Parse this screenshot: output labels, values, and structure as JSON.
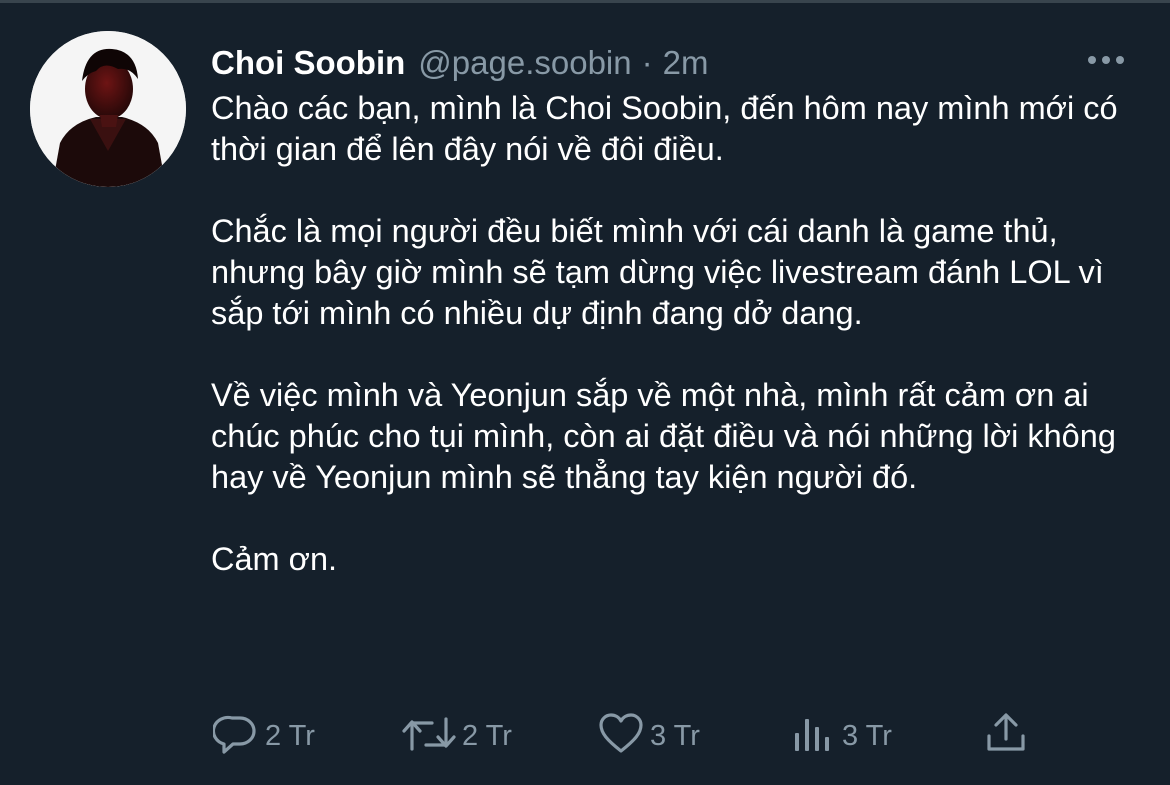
{
  "tweet": {
    "author_name": "Choi Soobin",
    "author_handle": "@page.soobin",
    "separator": "·",
    "timestamp": "2m",
    "paragraphs": [
      "Chào các bạn, mình là Choi Soobin, đến hôm nay mình mới có thời gian để lên đây nói về đôi điều.",
      "Chắc là mọi người đều biết mình với cái danh là game thủ, nhưng bây giờ mình sẽ tạm dừng việc livestream đánh LOL vì sắp tới mình có nhiều dự định đang dở dang.",
      "Về việc mình và Yeonjun sắp về một nhà, mình rất cảm ơn ai chúc phúc cho tụi mình, còn ai đặt điều và nói những lời không hay về Yeonjun mình sẽ thẳng tay kiện người đó.",
      "Cảm ơn."
    ]
  },
  "actions": {
    "reply": {
      "icon": "reply-icon",
      "count": "2 Tr"
    },
    "retweet": {
      "icon": "retweet-icon",
      "count": "2 Tr"
    },
    "like": {
      "icon": "heart-icon",
      "count": "3 Tr"
    },
    "analytics": {
      "icon": "analytics-icon",
      "count": "3 Tr"
    },
    "share": {
      "icon": "share-icon"
    }
  },
  "colors": {
    "background": "#15202b",
    "text_primary": "#ffffff",
    "text_secondary": "#8899a6",
    "divider": "#38444d"
  }
}
